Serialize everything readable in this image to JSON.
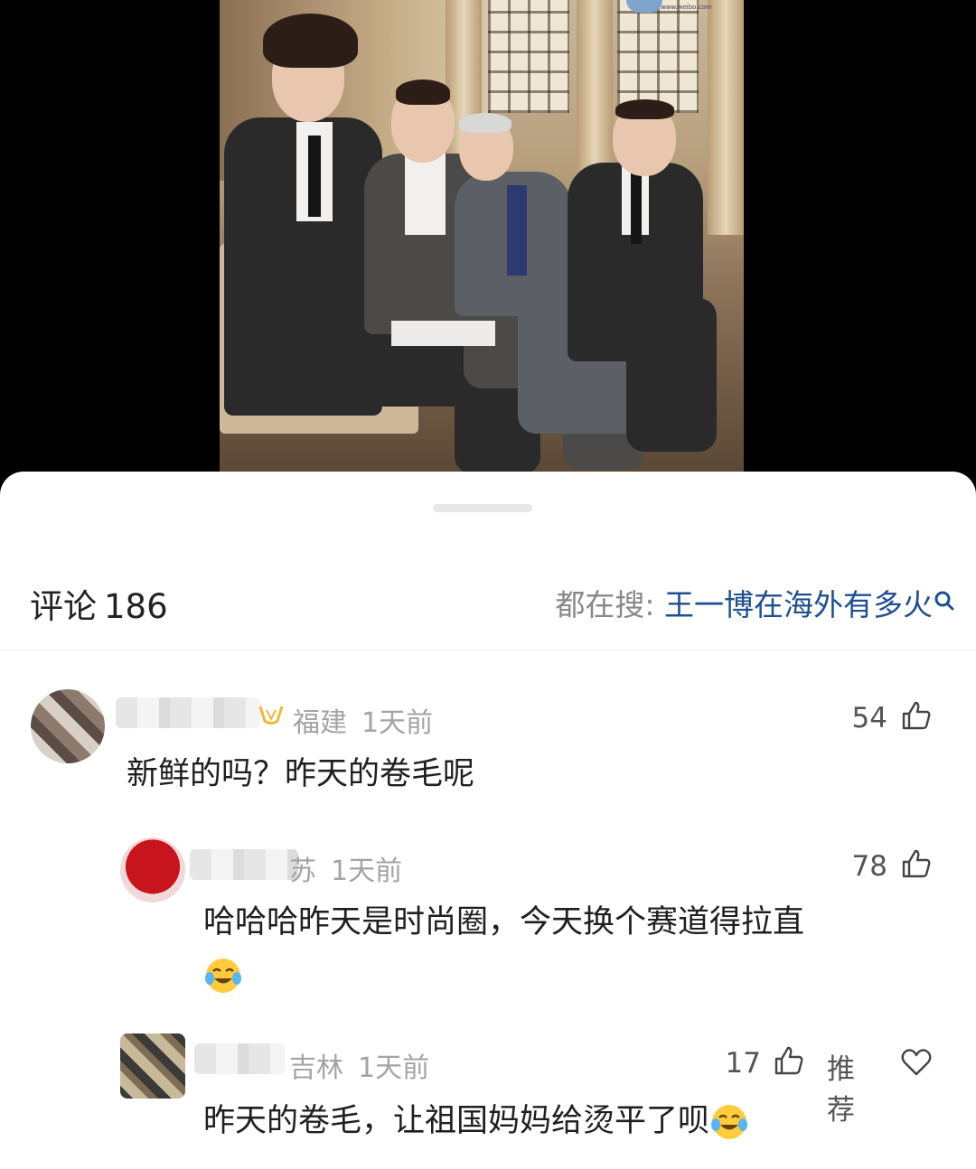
{
  "header": {
    "comments_label": "评论",
    "comments_count": "186",
    "hot_search_prefix": "都在搜:",
    "hot_search_term": "王一博在海外有多火"
  },
  "comments": [
    {
      "location": "福建",
      "time": "1天前",
      "text": "新鲜的吗？昨天的卷毛呢",
      "likes": "54"
    },
    {
      "location": "苏",
      "time": "1天前",
      "text": "哈哈哈昨天是时尚圈，今天换个赛道得拉直",
      "likes": "78",
      "emoji": "laughing-crying-emoji"
    },
    {
      "location": "吉林",
      "time": "1天前",
      "text": "昨天的卷毛，让祖国妈妈给烫平了呗",
      "likes": "17",
      "recommend_label": "推荐",
      "emoji": "laughing-crying-emoji"
    }
  ],
  "colors": {
    "accent_link": "#1f4f8f",
    "meta_gray": "#a4a4a4",
    "text_dark": "#1f1f1f",
    "vip_gold": "#f2b63a"
  },
  "icons": [
    "search-icon",
    "thumbs-up-icon",
    "heart-icon",
    "vip-badge-icon",
    "laughing-crying-emoji"
  ]
}
